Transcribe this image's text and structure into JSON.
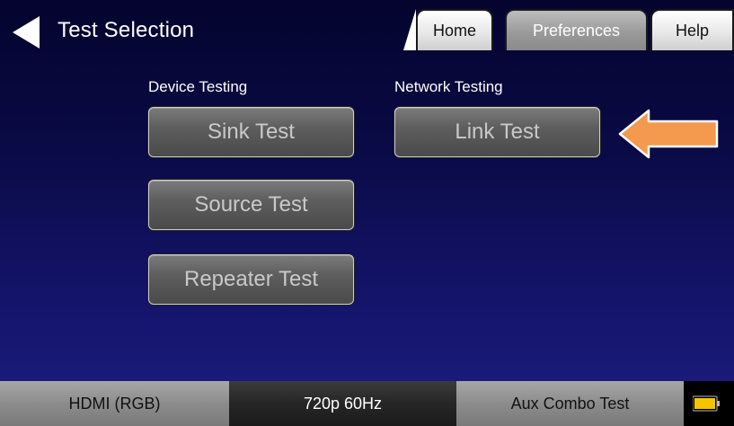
{
  "header": {
    "title": "Test Selection",
    "tabs": {
      "home": "Home",
      "preferences": "Preferences",
      "help": "Help"
    }
  },
  "sections": {
    "device": {
      "label": "Device Testing",
      "buttons": [
        "Sink Test",
        "Source Test",
        "Repeater Test"
      ]
    },
    "network": {
      "label": "Network Testing",
      "buttons": [
        "Link Test"
      ]
    }
  },
  "footer": {
    "left": "HDMI (RGB)",
    "center": "720p 60Hz",
    "right": "Aux Combo Test"
  },
  "colors": {
    "accent_arrow": "#f39a4f",
    "battery": "#f5c400"
  }
}
